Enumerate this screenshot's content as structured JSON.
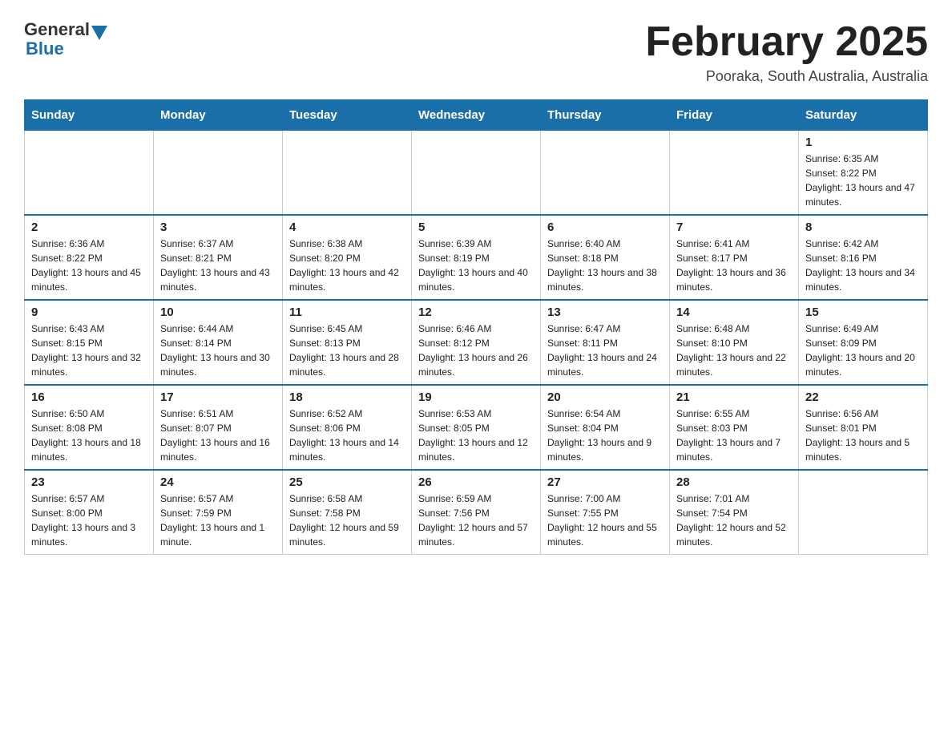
{
  "header": {
    "logo_general": "General",
    "logo_blue": "Blue",
    "title": "February 2025",
    "subtitle": "Pooraka, South Australia, Australia"
  },
  "days_of_week": [
    "Sunday",
    "Monday",
    "Tuesday",
    "Wednesday",
    "Thursday",
    "Friday",
    "Saturday"
  ],
  "weeks": [
    [
      {
        "day": "",
        "info": ""
      },
      {
        "day": "",
        "info": ""
      },
      {
        "day": "",
        "info": ""
      },
      {
        "day": "",
        "info": ""
      },
      {
        "day": "",
        "info": ""
      },
      {
        "day": "",
        "info": ""
      },
      {
        "day": "1",
        "info": "Sunrise: 6:35 AM\nSunset: 8:22 PM\nDaylight: 13 hours and 47 minutes."
      }
    ],
    [
      {
        "day": "2",
        "info": "Sunrise: 6:36 AM\nSunset: 8:22 PM\nDaylight: 13 hours and 45 minutes."
      },
      {
        "day": "3",
        "info": "Sunrise: 6:37 AM\nSunset: 8:21 PM\nDaylight: 13 hours and 43 minutes."
      },
      {
        "day": "4",
        "info": "Sunrise: 6:38 AM\nSunset: 8:20 PM\nDaylight: 13 hours and 42 minutes."
      },
      {
        "day": "5",
        "info": "Sunrise: 6:39 AM\nSunset: 8:19 PM\nDaylight: 13 hours and 40 minutes."
      },
      {
        "day": "6",
        "info": "Sunrise: 6:40 AM\nSunset: 8:18 PM\nDaylight: 13 hours and 38 minutes."
      },
      {
        "day": "7",
        "info": "Sunrise: 6:41 AM\nSunset: 8:17 PM\nDaylight: 13 hours and 36 minutes."
      },
      {
        "day": "8",
        "info": "Sunrise: 6:42 AM\nSunset: 8:16 PM\nDaylight: 13 hours and 34 minutes."
      }
    ],
    [
      {
        "day": "9",
        "info": "Sunrise: 6:43 AM\nSunset: 8:15 PM\nDaylight: 13 hours and 32 minutes."
      },
      {
        "day": "10",
        "info": "Sunrise: 6:44 AM\nSunset: 8:14 PM\nDaylight: 13 hours and 30 minutes."
      },
      {
        "day": "11",
        "info": "Sunrise: 6:45 AM\nSunset: 8:13 PM\nDaylight: 13 hours and 28 minutes."
      },
      {
        "day": "12",
        "info": "Sunrise: 6:46 AM\nSunset: 8:12 PM\nDaylight: 13 hours and 26 minutes."
      },
      {
        "day": "13",
        "info": "Sunrise: 6:47 AM\nSunset: 8:11 PM\nDaylight: 13 hours and 24 minutes."
      },
      {
        "day": "14",
        "info": "Sunrise: 6:48 AM\nSunset: 8:10 PM\nDaylight: 13 hours and 22 minutes."
      },
      {
        "day": "15",
        "info": "Sunrise: 6:49 AM\nSunset: 8:09 PM\nDaylight: 13 hours and 20 minutes."
      }
    ],
    [
      {
        "day": "16",
        "info": "Sunrise: 6:50 AM\nSunset: 8:08 PM\nDaylight: 13 hours and 18 minutes."
      },
      {
        "day": "17",
        "info": "Sunrise: 6:51 AM\nSunset: 8:07 PM\nDaylight: 13 hours and 16 minutes."
      },
      {
        "day": "18",
        "info": "Sunrise: 6:52 AM\nSunset: 8:06 PM\nDaylight: 13 hours and 14 minutes."
      },
      {
        "day": "19",
        "info": "Sunrise: 6:53 AM\nSunset: 8:05 PM\nDaylight: 13 hours and 12 minutes."
      },
      {
        "day": "20",
        "info": "Sunrise: 6:54 AM\nSunset: 8:04 PM\nDaylight: 13 hours and 9 minutes."
      },
      {
        "day": "21",
        "info": "Sunrise: 6:55 AM\nSunset: 8:03 PM\nDaylight: 13 hours and 7 minutes."
      },
      {
        "day": "22",
        "info": "Sunrise: 6:56 AM\nSunset: 8:01 PM\nDaylight: 13 hours and 5 minutes."
      }
    ],
    [
      {
        "day": "23",
        "info": "Sunrise: 6:57 AM\nSunset: 8:00 PM\nDaylight: 13 hours and 3 minutes."
      },
      {
        "day": "24",
        "info": "Sunrise: 6:57 AM\nSunset: 7:59 PM\nDaylight: 13 hours and 1 minute."
      },
      {
        "day": "25",
        "info": "Sunrise: 6:58 AM\nSunset: 7:58 PM\nDaylight: 12 hours and 59 minutes."
      },
      {
        "day": "26",
        "info": "Sunrise: 6:59 AM\nSunset: 7:56 PM\nDaylight: 12 hours and 57 minutes."
      },
      {
        "day": "27",
        "info": "Sunrise: 7:00 AM\nSunset: 7:55 PM\nDaylight: 12 hours and 55 minutes."
      },
      {
        "day": "28",
        "info": "Sunrise: 7:01 AM\nSunset: 7:54 PM\nDaylight: 12 hours and 52 minutes."
      },
      {
        "day": "",
        "info": ""
      }
    ]
  ]
}
